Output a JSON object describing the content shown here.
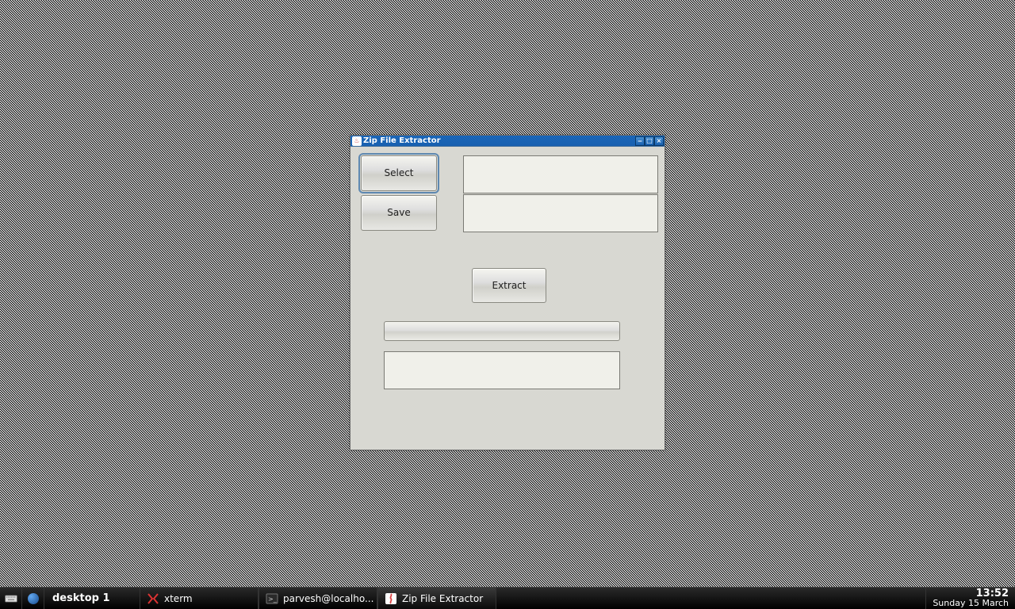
{
  "window": {
    "title": "Zip File Extractor",
    "buttons": {
      "select": "Select",
      "save": "Save",
      "extract": "Extract"
    },
    "fields": {
      "source": "",
      "destination": "",
      "status": ""
    }
  },
  "taskbar": {
    "desktop_label": "desktop 1",
    "items": [
      {
        "label": "xterm",
        "icon": "xterm"
      },
      {
        "label": "parvesh@localho...",
        "icon": "terminal"
      },
      {
        "label": "Zip File Extractor",
        "icon": "java",
        "active": true
      }
    ],
    "clock": {
      "time": "13:52",
      "date": "Sunday 15 March"
    }
  }
}
